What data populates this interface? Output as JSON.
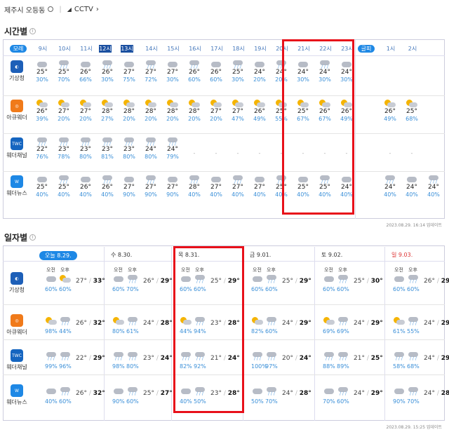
{
  "location": "제주시 오등동",
  "cctv": "CCTV",
  "hourly_title": "시간별",
  "daily_title": "일자별",
  "hours": [
    "모레",
    "9시",
    "10시",
    "11시",
    "12시",
    "13시",
    "14시",
    "15시",
    "16시",
    "17시",
    "18시",
    "19시",
    "20시",
    "21시",
    "22시",
    "23시",
    "글피",
    "1시",
    "2시"
  ],
  "sources": [
    "기상청",
    "아큐웨더",
    "웨더채널",
    "웨더뉴스"
  ],
  "hourly": [
    {
      "t": [
        "25°",
        "25°",
        "26°",
        "26°",
        "27°",
        "27°",
        "27°",
        "26°",
        "26°",
        "25°",
        "24°",
        "24°",
        "24°",
        "24°",
        "24°"
      ],
      "p": [
        "30%",
        "70%",
        "66%",
        "30%",
        "75%",
        "72%",
        "30%",
        "60%",
        "60%",
        "30%",
        "20%",
        "20%",
        "30%",
        "30%",
        "30%"
      ]
    },
    {
      "t": [
        "26°",
        "27°",
        "27°",
        "28°",
        "28°",
        "28°",
        "28°",
        "28°",
        "27°",
        "27°",
        "26°",
        "25°",
        "25°",
        "26°",
        "26°",
        "26°",
        "25°"
      ],
      "p": [
        "39%",
        "20%",
        "20%",
        "27%",
        "20%",
        "20%",
        "20%",
        "20%",
        "20%",
        "47%",
        "49%",
        "55%",
        "67%",
        "67%",
        "49%",
        "49%",
        "68%"
      ]
    },
    {
      "t": [
        "22°",
        "23°",
        "23°",
        "23°",
        "23°",
        "24°",
        "24°"
      ],
      "p": [
        "76%",
        "78%",
        "80%",
        "81%",
        "80%",
        "80%",
        "79%"
      ]
    },
    {
      "t": [
        "25°",
        "25°",
        "26°",
        "26°",
        "27°",
        "27°",
        "27°",
        "28°",
        "27°",
        "27°",
        "27°",
        "25°",
        "25°",
        "25°",
        "24°",
        "24°",
        "24°",
        "24°"
      ],
      "p": [
        "40%",
        "40%",
        "40%",
        "40%",
        "90%",
        "90%",
        "90%",
        "40%",
        "40%",
        "40%",
        "40%",
        "40%",
        "40%",
        "40%",
        "40%",
        "40%",
        "40%",
        "40%"
      ]
    }
  ],
  "hourly_footer": "2023.08.29. 16:14 업데이트",
  "days": [
    "오늘 8.29.",
    "수 8.30.",
    "목 8.31.",
    "금 9.01.",
    "토 9.02.",
    "일 9.03."
  ],
  "am": "오전",
  "pm": "오후",
  "daily": [
    [
      [
        "60%",
        "60%",
        "27°",
        "33°"
      ],
      [
        "60%",
        "70%",
        "26°",
        "29°"
      ],
      [
        "60%",
        "60%",
        "25°",
        "29°"
      ],
      [
        "60%",
        "60%",
        "25°",
        "29°"
      ],
      [
        "60%",
        "60%",
        "25°",
        "30°"
      ],
      [
        "60%",
        "60%",
        "26°",
        "29°"
      ]
    ],
    [
      [
        "98%",
        "44%",
        "26°",
        "32°"
      ],
      [
        "80%",
        "61%",
        "24°",
        "28°"
      ],
      [
        "44%",
        "94%",
        "23°",
        "28°"
      ],
      [
        "82%",
        "60%",
        "24°",
        "29°"
      ],
      [
        "69%",
        "69%",
        "24°",
        "29°"
      ],
      [
        "61%",
        "55%",
        "24°",
        "29°"
      ]
    ],
    [
      [
        "99%",
        "96%",
        "22°",
        "29°"
      ],
      [
        "98%",
        "80%",
        "23°",
        "24°"
      ],
      [
        "82%",
        "92%",
        "21°",
        "24°"
      ],
      [
        "100%",
        "97%",
        "20°",
        "24°"
      ],
      [
        "88%",
        "89%",
        "21°",
        "25°"
      ],
      [
        "58%",
        "68%",
        "24°",
        "29°"
      ]
    ],
    [
      [
        "40%",
        "60%",
        "26°",
        "32°"
      ],
      [
        "90%",
        "60%",
        "25°",
        "27°"
      ],
      [
        "40%",
        "50%",
        "23°",
        "28°"
      ],
      [
        "50%",
        "70%",
        "24°",
        "28°"
      ],
      [
        "70%",
        "60%",
        "24°",
        "29°"
      ],
      [
        "90%",
        "70%",
        "24°",
        "28°"
      ]
    ]
  ],
  "daily_footer": "2023.08.29. 15:25 업데이트"
}
